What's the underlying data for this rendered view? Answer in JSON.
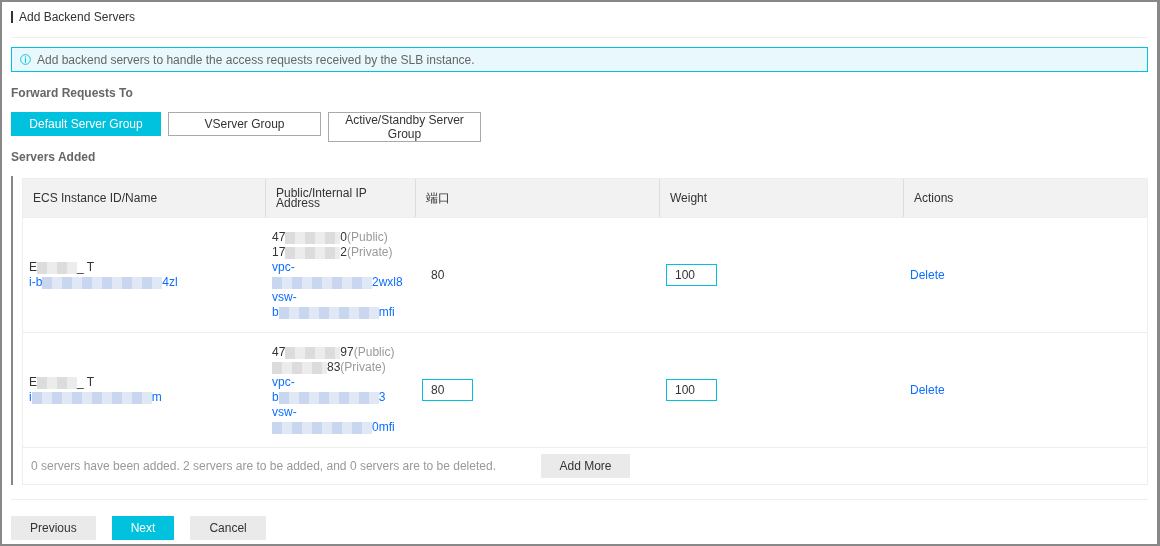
{
  "title": "Add Backend Servers",
  "info": "Add backend servers to handle the access requests received by the SLB instance.",
  "forward_label": "Forward Requests To",
  "server_groups": [
    {
      "label": "Default Server Group",
      "selected": true
    },
    {
      "label": "VServer Group",
      "selected": false
    },
    {
      "label": "Active/Standby Server Group",
      "selected": false
    }
  ],
  "servers_label": "Servers Added",
  "table": {
    "columns": [
      "ECS Instance ID/Name",
      "Public/Internal IP Address",
      "端口",
      "Weight",
      "Actions"
    ],
    "rows": [
      {
        "name": {
          "prefix": "E",
          "suffix": "_ T"
        },
        "instance_id": {
          "prefix": "i-b",
          "suffix": "4zl"
        },
        "address": [
          {
            "kind": "plain",
            "redacted": true,
            "prefix": "47",
            "suffix": "0",
            "note": "(Public)"
          },
          {
            "kind": "plain",
            "redacted": true,
            "prefix": "17",
            "suffix": "2",
            "note": "(Private)"
          },
          {
            "kind": "link",
            "redacted": false,
            "prefix": "vpc-"
          },
          {
            "kind": "link",
            "redacted": true,
            "suffix": "2wxl8"
          },
          {
            "kind": "link",
            "redacted": false,
            "prefix": "vsw-"
          },
          {
            "kind": "link",
            "redacted": true,
            "prefix": "b",
            "suffix": "mfi"
          }
        ],
        "port": {
          "kind": "text",
          "value": "80"
        },
        "weight": "100",
        "action": "Delete"
      },
      {
        "name": {
          "prefix": "E",
          "suffix": "_ T"
        },
        "instance_id": {
          "prefix": "i",
          "suffix": "m"
        },
        "address": [
          {
            "kind": "plain",
            "redacted": true,
            "prefix": "47",
            "suffix": "97",
            "note": "(Public)"
          },
          {
            "kind": "plain",
            "redacted": true,
            "suffix": "83",
            "note": "(Private)"
          },
          {
            "kind": "link",
            "redacted": false,
            "prefix": "vpc-"
          },
          {
            "kind": "link",
            "redacted": true,
            "prefix": "b",
            "suffix": "3"
          },
          {
            "kind": "link",
            "redacted": false,
            "prefix": "vsw-"
          },
          {
            "kind": "link",
            "redacted": true,
            "suffix": "0mfi"
          }
        ],
        "port": {
          "kind": "input",
          "value": "80"
        },
        "weight": "100",
        "action": "Delete"
      }
    ],
    "summary": "0 servers have been added. 2 servers are to be added, and 0 servers are to be deleted.",
    "add_more": "Add More"
  },
  "footer_buttons": [
    {
      "label": "Previous",
      "primary": false
    },
    {
      "label": "Next",
      "primary": true
    },
    {
      "label": "Cancel",
      "primary": false
    }
  ]
}
